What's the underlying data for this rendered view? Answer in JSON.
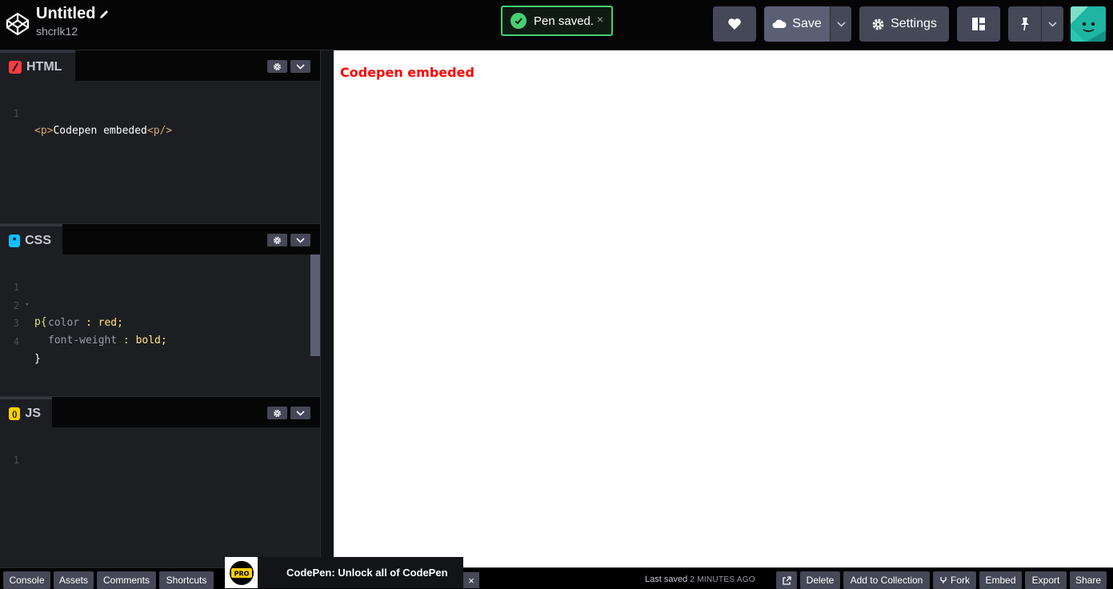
{
  "header": {
    "title": "Untitled",
    "username": "shcrlk12",
    "toast": "Pen saved.",
    "toast_close": "×",
    "save_label": "Save",
    "settings_label": "Settings"
  },
  "editors": {
    "html": {
      "label": "HTML",
      "lines": [
        {
          "n": "1",
          "open": "<p>",
          "text": "Codepen embeded",
          "close": "<p/>"
        }
      ]
    },
    "css": {
      "label": "CSS",
      "icon_glyph": "*",
      "lines": [
        {
          "n": "1"
        },
        {
          "n": "2"
        },
        {
          "n": "3"
        },
        {
          "n": "4"
        }
      ],
      "selector": "p{",
      "prop1": "color",
      "val1": "red;",
      "prop2": "font-weight",
      "val2": "bold;",
      "close": "}",
      "colon": " : "
    },
    "js": {
      "label": "JS",
      "icon_glyph": "()",
      "lines": [
        {
          "n": "1"
        }
      ]
    }
  },
  "preview": {
    "text": "Codepen embeded"
  },
  "footer": {
    "console": "Console",
    "assets": "Assets",
    "comments": "Comments",
    "shortcuts": "Shortcuts",
    "promo": "CodePen: Unlock all of CodePen",
    "promo_badge": "PRO",
    "promo_close": "×",
    "last_saved": "Last saved",
    "last_saved_ago": "2 MINUTES AGO",
    "delete": "Delete",
    "add_to_collection": "Add to Collection",
    "fork": "Fork",
    "embed": "Embed",
    "export": "Export",
    "share": "Share"
  },
  "colors": {
    "accent_green": "#47cf73",
    "html_icon": "#ff3c41",
    "css_icon": "#0ebeff",
    "js_icon": "#fcd000",
    "preview_text": "#ff0000"
  }
}
